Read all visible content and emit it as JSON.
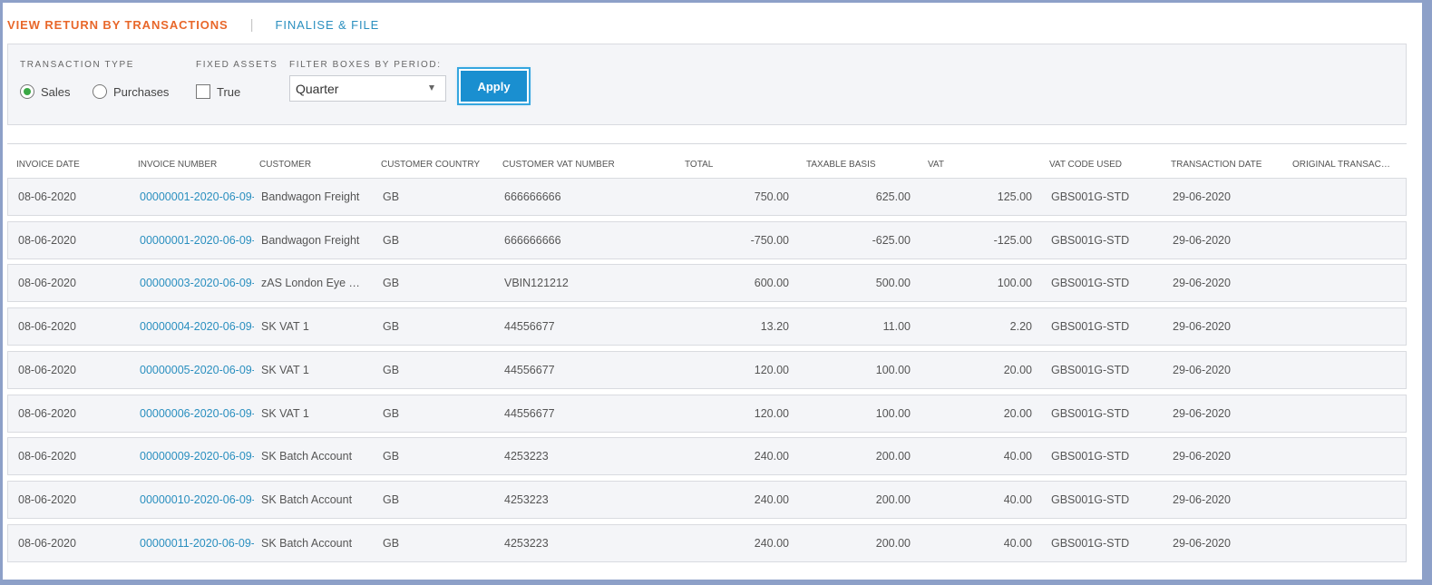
{
  "tabs": {
    "active": "VIEW RETURN BY TRANSACTIONS",
    "finalise": "FINALISE & FILE",
    "separator": "|"
  },
  "filters": {
    "transaction_type_label": "TRANSACTION TYPE",
    "sales_label": "Sales",
    "purchases_label": "Purchases",
    "fixed_assets_label": "FIXED ASSETS",
    "true_label": "True",
    "period_label": "FILTER BOXES BY PERIOD:",
    "period_value": "Quarter",
    "apply_label": "Apply"
  },
  "table": {
    "headers": [
      "INVOICE DATE",
      "INVOICE NUMBER",
      "CUSTOMER",
      "CUSTOMER COUNTRY",
      "CUSTOMER VAT NUMBER",
      "TOTAL",
      "TAXABLE BASIS",
      "VAT",
      "VAT CODE USED",
      "TRANSACTION DATE",
      "ORIGINAL TRANSACTION"
    ],
    "rows": [
      {
        "invoice_date": "08-06-2020",
        "invoice_number": "00000001-2020-06-09-",
        "customer": "Bandwagon Freight",
        "country": "GB",
        "vat_number": "666666666",
        "total": "750.00",
        "taxable_basis": "625.00",
        "vat": "125.00",
        "vat_code": "GBS001G-STD",
        "transaction_date": "29-06-2020"
      },
      {
        "invoice_date": "08-06-2020",
        "invoice_number": "00000001-2020-06-09-",
        "customer": "Bandwagon Freight",
        "country": "GB",
        "vat_number": "666666666",
        "total": "-750.00",
        "taxable_basis": "-625.00",
        "vat": "-125.00",
        "vat_code": "GBS001G-STD",
        "transaction_date": "29-06-2020"
      },
      {
        "invoice_date": "08-06-2020",
        "invoice_number": "00000003-2020-06-09-",
        "customer": "zAS London Eye Tours",
        "country": "GB",
        "vat_number": "VBIN121212",
        "total": "600.00",
        "taxable_basis": "500.00",
        "vat": "100.00",
        "vat_code": "GBS001G-STD",
        "transaction_date": "29-06-2020"
      },
      {
        "invoice_date": "08-06-2020",
        "invoice_number": "00000004-2020-06-09-",
        "customer": "SK VAT 1",
        "country": "GB",
        "vat_number": "44556677",
        "total": "13.20",
        "taxable_basis": "11.00",
        "vat": "2.20",
        "vat_code": "GBS001G-STD",
        "transaction_date": "29-06-2020"
      },
      {
        "invoice_date": "08-06-2020",
        "invoice_number": "00000005-2020-06-09-",
        "customer": "SK VAT 1",
        "country": "GB",
        "vat_number": "44556677",
        "total": "120.00",
        "taxable_basis": "100.00",
        "vat": "20.00",
        "vat_code": "GBS001G-STD",
        "transaction_date": "29-06-2020"
      },
      {
        "invoice_date": "08-06-2020",
        "invoice_number": "00000006-2020-06-09-",
        "customer": "SK VAT 1",
        "country": "GB",
        "vat_number": "44556677",
        "total": "120.00",
        "taxable_basis": "100.00",
        "vat": "20.00",
        "vat_code": "GBS001G-STD",
        "transaction_date": "29-06-2020"
      },
      {
        "invoice_date": "08-06-2020",
        "invoice_number": "00000009-2020-06-09-",
        "customer": "SK Batch Account",
        "country": "GB",
        "vat_number": "4253223",
        "total": "240.00",
        "taxable_basis": "200.00",
        "vat": "40.00",
        "vat_code": "GBS001G-STD",
        "transaction_date": "29-06-2020"
      },
      {
        "invoice_date": "08-06-2020",
        "invoice_number": "00000010-2020-06-09-",
        "customer": "SK Batch Account",
        "country": "GB",
        "vat_number": "4253223",
        "total": "240.00",
        "taxable_basis": "200.00",
        "vat": "40.00",
        "vat_code": "GBS001G-STD",
        "transaction_date": "29-06-2020"
      },
      {
        "invoice_date": "08-06-2020",
        "invoice_number": "00000011-2020-06-09-",
        "customer": "SK Batch Account",
        "country": "GB",
        "vat_number": "4253223",
        "total": "240.00",
        "taxable_basis": "200.00",
        "vat": "40.00",
        "vat_code": "GBS001G-STD",
        "transaction_date": "29-06-2020"
      }
    ]
  },
  "colors": {
    "accent_orange": "#e8672a",
    "link_blue": "#2a8fbf",
    "button_blue": "#1a8fd0",
    "radio_green": "#3aa845"
  },
  "icons": {
    "radio_selected": "radio-selected-icon",
    "radio_empty": "radio-empty-icon",
    "checkbox": "checkbox-empty-icon",
    "caret": "caret-down-icon"
  }
}
